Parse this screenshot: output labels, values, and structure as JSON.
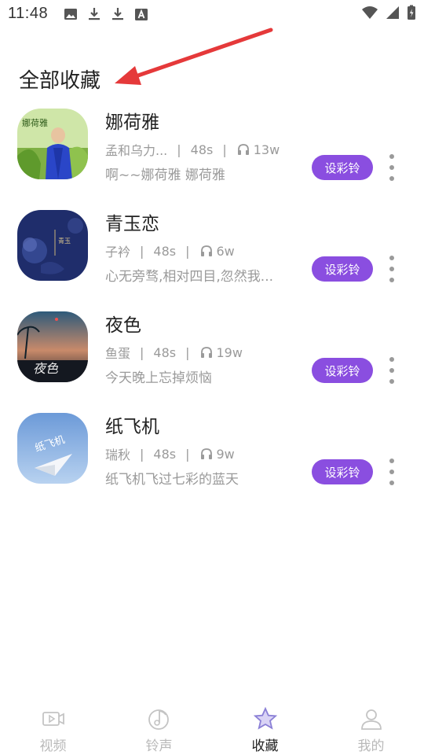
{
  "status_bar": {
    "time": "11:48",
    "left_icons": [
      "image-icon",
      "download-icon",
      "download-icon",
      "font-icon"
    ],
    "right_icons": [
      "wifi-icon",
      "signal-icon",
      "battery-charging-icon"
    ]
  },
  "header": {
    "title": "全部收藏"
  },
  "annotation": {
    "arrow_color": "#e5393a"
  },
  "accent_color": "#8a4ee0",
  "songs": [
    {
      "title": "娜荷雅",
      "artist": "孟和乌力...",
      "duration": "48s",
      "plays": "13w",
      "desc": "啊~~娜荷雅 娜荷雅",
      "button": "设彩铃"
    },
    {
      "title": "青玉恋",
      "artist": "子衿",
      "duration": "48s",
      "plays": "6w",
      "desc": "心无旁骛,相对四目,忽然我...",
      "button": "设彩铃"
    },
    {
      "title": "夜色",
      "artist": "鱼蛋",
      "duration": "48s",
      "plays": "19w",
      "desc": "今天晚上忘掉烦恼",
      "button": "设彩铃"
    },
    {
      "title": "纸飞机",
      "artist": "瑞秋",
      "duration": "48s",
      "plays": "9w",
      "desc": "纸飞机飞过七彩的蓝天",
      "button": "设彩铃"
    }
  ],
  "bottom_nav": [
    {
      "label": "视频",
      "icon": "video-icon",
      "active": false
    },
    {
      "label": "铃声",
      "icon": "music-note-icon",
      "active": false
    },
    {
      "label": "收藏",
      "icon": "star-icon",
      "active": true
    },
    {
      "label": "我的",
      "icon": "person-icon",
      "active": false
    }
  ]
}
